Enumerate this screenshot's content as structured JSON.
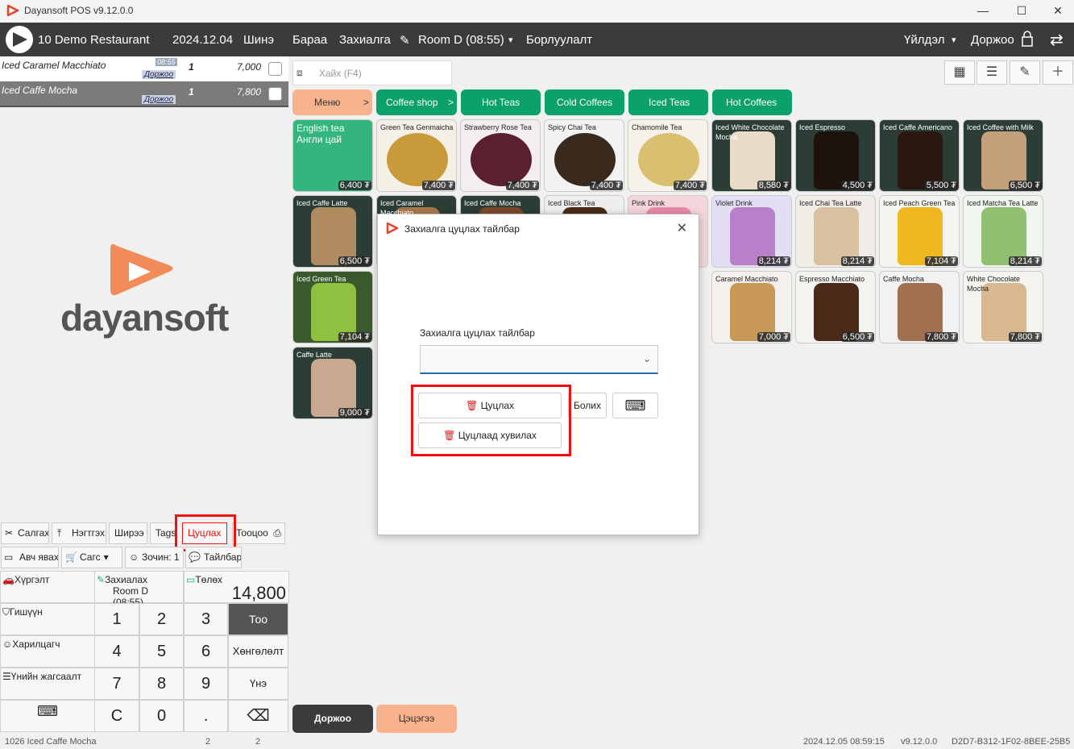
{
  "window": {
    "title": "Dayansoft POS v9.12.0.0",
    "minimize": "—",
    "maximize": "☐",
    "close": "✕"
  },
  "menu": {
    "restaurant": "10 Demo Restaurant",
    "date": "2024.12.04",
    "items": [
      "Шинэ",
      "Бараа",
      "Захиалга",
      "Room D (08:55)",
      "Борлуулалт"
    ],
    "actions": "Үйлдэл",
    "user": "Доржоо"
  },
  "order": {
    "rows": [
      {
        "name": "Iced Caramel Macchiato",
        "time": "08:55",
        "waiter": "Доржоо",
        "qty": "1",
        "price": "7,000"
      },
      {
        "name": "Iced Caffe Mocha",
        "time": "",
        "waiter": "Доржоо",
        "qty": "1",
        "price": "7,800"
      }
    ]
  },
  "brand": {
    "name": "dayansoft"
  },
  "order_buttons": {
    "row1": [
      "Салгах",
      "Нэгтгэх",
      "Ширээ",
      "Tags",
      "Цуцлах",
      "Тооцоо"
    ],
    "row2": [
      "Авч явах",
      "Сагс",
      "Зочин: 1",
      "Тайлбар"
    ]
  },
  "summary": {
    "delivery": "Хүргэлт",
    "order_label": "Захиалах",
    "order_room": "Room D (08:55)",
    "phone": "Төлөх",
    "total": "14,800"
  },
  "left_labels": [
    "Гишүүн",
    "Харилцагч",
    "Үнийн жагсаалт"
  ],
  "keypad": {
    "digits": [
      "1",
      "2",
      "3",
      "4",
      "5",
      "6",
      "7",
      "8",
      "9",
      "C",
      "0",
      "."
    ],
    "qty": "Тоо",
    "discount": "Хөнгөлөлт",
    "price": "Үнэ"
  },
  "search": {
    "placeholder": "Хайх (F4)"
  },
  "categories": [
    "Меню",
    "Coffee shop",
    "Hot Teas",
    "Cold Coffees",
    "Iced Teas",
    "Hot Coffees"
  ],
  "products": [
    {
      "name": "English tea\nАнгли цай",
      "price": "6,400 ₮"
    },
    {
      "name": "Green Tea Genmaicha",
      "price": "7,400 ₮"
    },
    {
      "name": "Strawberry Rose Tea",
      "price": "7,400 ₮"
    },
    {
      "name": "Spicy Chai Tea",
      "price": "7,400 ₮"
    },
    {
      "name": "Chamomile Tea",
      "price": "7,400 ₮"
    },
    {
      "name": "Iced White Chocolate Mocha",
      "price": "8,580 ₮"
    },
    {
      "name": "Iced Espresso",
      "price": "4,500 ₮"
    },
    {
      "name": "Iced Caffe Americano",
      "price": "5,500 ₮"
    },
    {
      "name": "Iced Coffee with Milk",
      "price": "6,500 ₮"
    },
    {
      "name": "Iced Caffe Latte",
      "price": "6,500 ₮"
    },
    {
      "name": "Iced Caramel Macchiato",
      "price": ""
    },
    {
      "name": "Iced Caffe Mocha",
      "price": ""
    },
    {
      "name": "Iced Black Tea",
      "price": ""
    },
    {
      "name": "Pink Drink",
      "price": ""
    },
    {
      "name": "Violet Drink",
      "price": "8,214 ₮"
    },
    {
      "name": "Iced Chai Tea Latte",
      "price": "8,214 ₮"
    },
    {
      "name": "Iced Peach Green Tea",
      "price": "7,104 ₮"
    },
    {
      "name": "Iced Matcha Tea Latte",
      "price": "8,214 ₮"
    },
    {
      "name": "Iced Green Tea",
      "price": "7,104 ₮"
    },
    {
      "name": "Caramel Macchiato",
      "price": "7,000 ₮"
    },
    {
      "name": "Espresso Macchiato",
      "price": "6,500 ₮"
    },
    {
      "name": "Caffe Mocha",
      "price": "7,800 ₮"
    },
    {
      "name": "White Chocolate Mocha",
      "price": "7,800 ₮"
    },
    {
      "name": "Caffe Latte",
      "price": "9,000 ₮"
    }
  ],
  "bottom": {
    "user_btn": "Доржоо",
    "clear_btn": "Цэцэгээ"
  },
  "dialog": {
    "title": "Захиалга цуцлах тайлбар",
    "label": "Захиалга цуцлах тайлбар",
    "cancel": "Цуцлах",
    "cancel_split": "Цуцлаад хувилах",
    "close": "Болих"
  },
  "status": {
    "item": "1026 Iced Caffe Mocha",
    "c1": "2",
    "c2": "2",
    "datetime": "2024.12.05 08:59:15",
    "version": "v9.12.0.0",
    "key": "D2D7-B312-1F02-8BEE-25B5"
  },
  "colors": {
    "accent_green": "#0aa26a",
    "salmon": "#f8b38c",
    "menubar": "#3b3b3b",
    "red_highlight": "#e11111"
  }
}
